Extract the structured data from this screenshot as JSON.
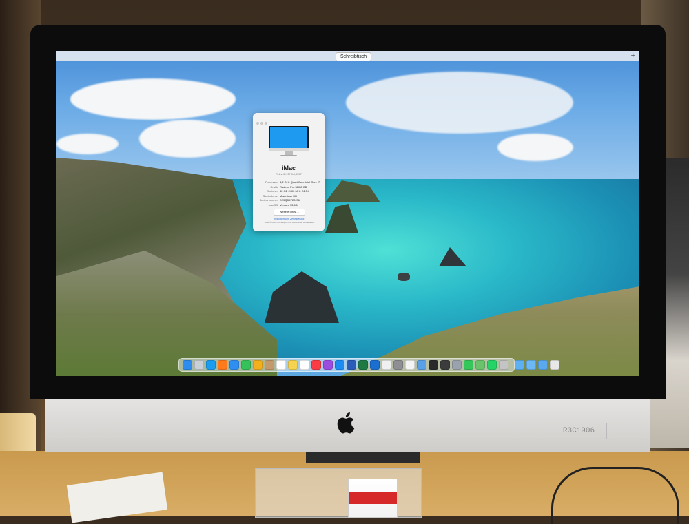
{
  "menu_bar": {
    "space_label": "Schreibtisch",
    "add_space_symbol": "+"
  },
  "about_window": {
    "title": "iMac",
    "subtitle": "Retina 5K, 27 Zoll, 2017",
    "specs": [
      {
        "label": "Prozessor",
        "value": "4,2 GHz Quad-Core Intel Core i7"
      },
      {
        "label": "Grafik",
        "value": "Radeon Pro 580 8 GB"
      },
      {
        "label": "Speicher",
        "value": "32 GB 2400 MHz DDR4"
      },
      {
        "label": "Startvolume",
        "value": "Macintosh HD"
      },
      {
        "label": "Seriennummer",
        "value": "D25QD4T22J36"
      },
      {
        "label": "macOS",
        "value": "Ventura 13.6.1"
      }
    ],
    "more_info_button": "Weitere Infos …",
    "certificate_link": "Regulatorische Zertifizierung",
    "legal_text": "™ und © 1983–2023 Apple Inc. Alle Rechte vorbehalten."
  },
  "dock": {
    "apps": [
      {
        "name": "finder-icon",
        "color": "#2d8cf0"
      },
      {
        "name": "launchpad-icon",
        "color": "#c9cfd6"
      },
      {
        "name": "safari-icon",
        "color": "#1a9cf0"
      },
      {
        "name": "firefox-icon",
        "color": "#ff7a1a"
      },
      {
        "name": "mail-icon",
        "color": "#2f8ff0"
      },
      {
        "name": "messages-icon",
        "color": "#36c25a"
      },
      {
        "name": "photos-icon",
        "color": "#f2b01e"
      },
      {
        "name": "contacts-icon",
        "color": "#c49a6c"
      },
      {
        "name": "calendar-icon",
        "color": "#ffffff"
      },
      {
        "name": "notes-icon",
        "color": "#f5d34f"
      },
      {
        "name": "reminders-icon",
        "color": "#ffffff"
      },
      {
        "name": "music-icon",
        "color": "#fc3c44"
      },
      {
        "name": "podcasts-icon",
        "color": "#9b4de0"
      },
      {
        "name": "app-store-icon",
        "color": "#1b8cf2"
      },
      {
        "name": "word-icon",
        "color": "#2b5cb8"
      },
      {
        "name": "excel-icon",
        "color": "#1e7a45"
      },
      {
        "name": "outlook-icon",
        "color": "#1a6fd1"
      },
      {
        "name": "chrome-icon",
        "color": "#f0f0f0"
      },
      {
        "name": "system-settings-icon",
        "color": "#8e8e93"
      },
      {
        "name": "textedit-icon",
        "color": "#f4f4f4"
      },
      {
        "name": "preview-icon",
        "color": "#5aa0e8"
      },
      {
        "name": "terminal-icon",
        "color": "#2a2a2a"
      },
      {
        "name": "activity-monitor-icon",
        "color": "#3c3c3c"
      },
      {
        "name": "disk-utility-icon",
        "color": "#9aa3ad"
      },
      {
        "name": "facetime-icon",
        "color": "#34c759"
      },
      {
        "name": "maps-icon",
        "color": "#6ac26a"
      },
      {
        "name": "whatsapp-icon",
        "color": "#25d366"
      },
      {
        "name": "keychain-icon",
        "color": "#c4c4c4"
      }
    ],
    "folders": [
      {
        "name": "applications-folder-icon",
        "color": "#5db0f2"
      },
      {
        "name": "documents-folder-icon",
        "color": "#6cb8f5"
      },
      {
        "name": "downloads-folder-icon",
        "color": "#5aa8ee"
      },
      {
        "name": "trash-icon",
        "color": "#e8e8e8"
      }
    ]
  },
  "chin": {
    "sticker_text": "R3C1906"
  },
  "colors": {
    "bezel": "#0c0c0d",
    "chin": "#dcdbd8",
    "desk": "#d2a55d"
  }
}
